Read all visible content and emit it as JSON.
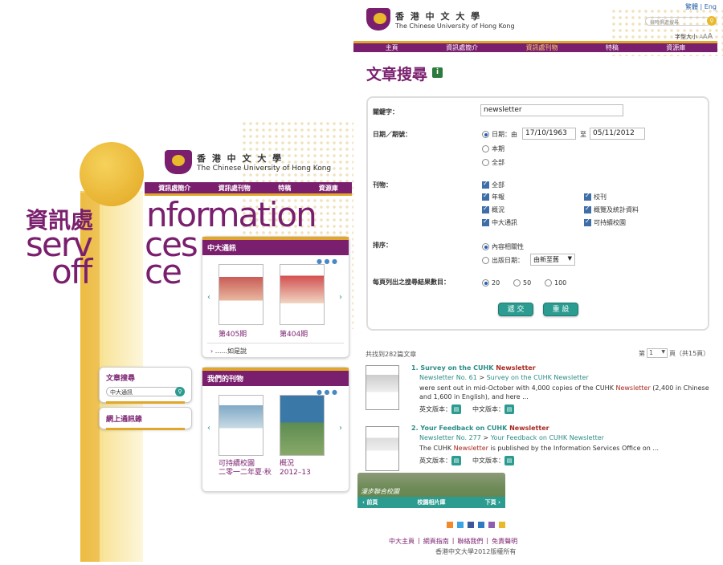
{
  "left": {
    "logo_cn": "香 港 中 文 大 學",
    "logo_en": "The Chinese University of Hong Kong",
    "nav": [
      "資訊處簡介",
      "資訊處刊物",
      "特稿",
      "資源庫"
    ],
    "brand_cn": "資訊處",
    "brand_lines": [
      "nformation",
      "serv",
      "ces",
      "off",
      "ce"
    ],
    "newsletter_panel": {
      "title": "中大通訊",
      "items": [
        {
          "label": "第405期"
        },
        {
          "label": "第404期"
        }
      ],
      "more": "......如是說"
    },
    "publications_panel": {
      "title": "我們的刊物",
      "items": [
        {
          "label": "可持續校園\n二零一二年夏‧秋"
        },
        {
          "label": "概況\n2012–13"
        }
      ]
    },
    "search_box": {
      "title": "文章搜尋",
      "value": "中大通訊"
    },
    "newsletter_link": "網上通訊錄"
  },
  "right": {
    "logo_cn": "香 港 中 文 大 學",
    "logo_en": "The Chinese University of Hong Kong",
    "lang_links": "繁體 | Eng",
    "search_placeholder": "與時俱進搜尋",
    "font_size_label": "字型大小",
    "nav": [
      "主頁",
      "資訊處簡介",
      "資訊處刊物",
      "特稿",
      "資源庫"
    ],
    "page_title": "文章搜尋",
    "form": {
      "keyword_label": "關鍵字：",
      "keyword_value": "newsletter",
      "date_label": "日期／期號：",
      "date_opt": "日期：由",
      "date_from": "17/10/1963",
      "date_to_label": "至",
      "date_to": "05/11/2012",
      "opt_current": "本期",
      "opt_all": "全部",
      "pub_label": "刊物：",
      "pubs_left": [
        "全部",
        "年報",
        "概況",
        "中大通訊"
      ],
      "pubs_right": [
        "校刊",
        "概覽及統計資料",
        "可持續校園"
      ],
      "sort_label": "排序：",
      "sort_relevance": "內容相關性",
      "sort_date": "出版日期：",
      "sort_date_select": "由新至舊",
      "per_page_label": "每頁列出之搜尋結果數目：",
      "per_page_opts": [
        "20",
        "50",
        "100"
      ],
      "submit": "遞 交",
      "reset": "重 設"
    },
    "results_count": "共找到282篇文章",
    "pager": {
      "prefix": "第",
      "page": "1",
      "suffix": "頁（共15頁）"
    },
    "results": [
      {
        "num": "1.",
        "title_pre": "Survey on the CUHK ",
        "title_hl": "Newsletter",
        "path_pre": "Newsletter No. 61",
        "path_sep": " > ",
        "path_post": "Survey on the CUHK Newsletter",
        "body_pre": "were sent out in mid-October with 4,000 copies of the CUHK ",
        "body_hl": "Newsletter",
        "body_post": " (2,400 in Chinese and 1,600 in English), and here ...",
        "en_label": "英文版本：",
        "cn_label": "中文版本："
      },
      {
        "num": "2.",
        "title_pre": "Your Feedback on CUHK ",
        "title_hl": "Newsletter",
        "path_pre": "Newsletter No. 277",
        "path_sep": " > ",
        "path_post": "Your Feedback on CUHK Newsletter",
        "body_pre": "The CUHK ",
        "body_hl": "Newsletter",
        "body_post": " is published by the Information Services Office on ...",
        "en_label": "英文版本：",
        "cn_label": "中文版本："
      }
    ],
    "photo_caption": "漫步聯合校園",
    "photo_nav": [
      "前頁",
      "校園相片庫",
      "下頁"
    ],
    "footer_links": [
      "中大主頁",
      "網頁指南",
      "聯絡我們",
      "免責聲明"
    ],
    "copyright": "香港中文大學2012版權所有",
    "colors": {
      "purple": "#7a1f6e",
      "gold": "#e0a72a",
      "teal": "#2c9c91",
      "red": "#a8281f"
    }
  }
}
